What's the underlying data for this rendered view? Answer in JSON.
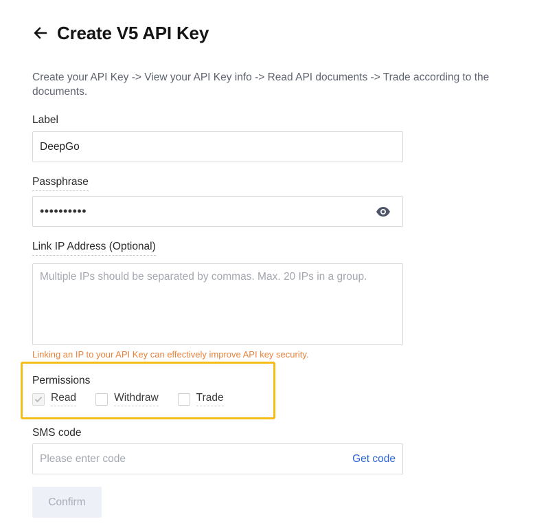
{
  "header": {
    "title": "Create V5 API Key",
    "back_icon": "arrow-left-icon"
  },
  "intro": "Create your API Key -> View your API Key info -> Read API documents -> Trade according to the documents.",
  "label_field": {
    "label": "Label",
    "value": "DeepGo"
  },
  "passphrase_field": {
    "label": "Passphrase",
    "value": "••••••••••",
    "toggle_icon": "eye-icon"
  },
  "ip_field": {
    "label": "Link IP Address (Optional)",
    "placeholder": "Multiple IPs should be separated by commas. Max. 20 IPs in a group.",
    "hint": "Linking an IP to your API Key can effectively improve API key security."
  },
  "permissions": {
    "label": "Permissions",
    "options": [
      {
        "label": "Read",
        "checked": true,
        "disabled": true
      },
      {
        "label": "Withdraw",
        "checked": false
      },
      {
        "label": "Trade",
        "checked": false
      }
    ]
  },
  "sms_field": {
    "label": "SMS code",
    "placeholder": "Please enter code",
    "get_code": "Get code"
  },
  "confirm_button": "Confirm",
  "colors": {
    "highlight": "#f5bd18",
    "hint": "#e8823a",
    "link": "#2c63d6"
  }
}
